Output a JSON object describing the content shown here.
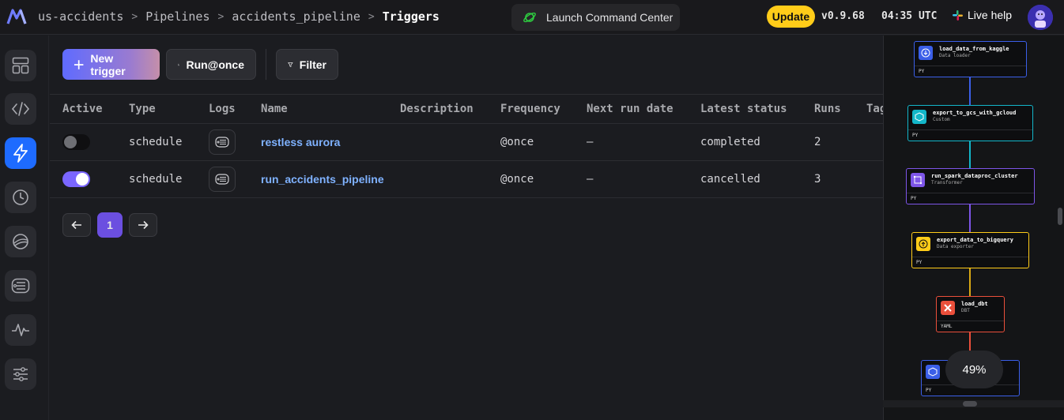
{
  "header": {
    "breadcrumbs": [
      "us-accidents",
      "Pipelines",
      "accidents_pipeline",
      "Triggers"
    ],
    "launch_label": "Launch Command Center",
    "update_label": "Update",
    "version": "v0.9.68",
    "time": "04:35 UTC",
    "help_label": "Live help"
  },
  "sidebar": {
    "items": [
      "dashboard-icon",
      "code-icon",
      "lightning-icon",
      "clock-icon",
      "planet-icon",
      "logs-icon",
      "monitor-icon",
      "settings-icon"
    ],
    "active": "lightning-icon"
  },
  "toolbar": {
    "new_trigger": "New trigger",
    "run_once": "Run@once",
    "filter": "Filter"
  },
  "table": {
    "headers": [
      "Active",
      "Type",
      "Logs",
      "Name",
      "Description",
      "Frequency",
      "Next run date",
      "Latest status",
      "Runs",
      "Tags"
    ],
    "rows": [
      {
        "active": false,
        "type": "schedule",
        "name": "restless aurora",
        "description": "",
        "frequency": "@once",
        "next_run": "–",
        "status": "completed",
        "runs": "2"
      },
      {
        "active": true,
        "type": "schedule",
        "name": "run_accidents_pipeline",
        "description": "",
        "frequency": "@once",
        "next_run": "–",
        "status": "cancelled",
        "runs": "3"
      }
    ]
  },
  "pagination": {
    "current": "1"
  },
  "graph": {
    "nodes": [
      {
        "title": "load_data_from_kaggle",
        "subtitle": "Data loader",
        "lang": "PY",
        "color": "#3b5fe8"
      },
      {
        "title": "export_to_gcs_with_gcloud",
        "subtitle": "Custom",
        "lang": "PY",
        "color": "#13b6c9"
      },
      {
        "title": "run_spark_dataproc_cluster",
        "subtitle": "Transformer",
        "lang": "PY",
        "color": "#7d55e8"
      },
      {
        "title": "export_data_to_bigquery",
        "subtitle": "Data exporter",
        "lang": "PY",
        "color": "#ffcc19"
      },
      {
        "title": "load_dbt",
        "subtitle": "DBT",
        "lang": "YAML",
        "color": "#ea4f3b"
      },
      {
        "title": "",
        "subtitle": "",
        "lang": "PY",
        "color": "#3b5fe8"
      }
    ],
    "zoom": "49%"
  },
  "colors": {
    "accent": "#7a66ff",
    "active_nav": "#1e6bff",
    "completed": "#1ec454",
    "cancelled": "#ffcc19",
    "link": "#7fb2ff"
  }
}
